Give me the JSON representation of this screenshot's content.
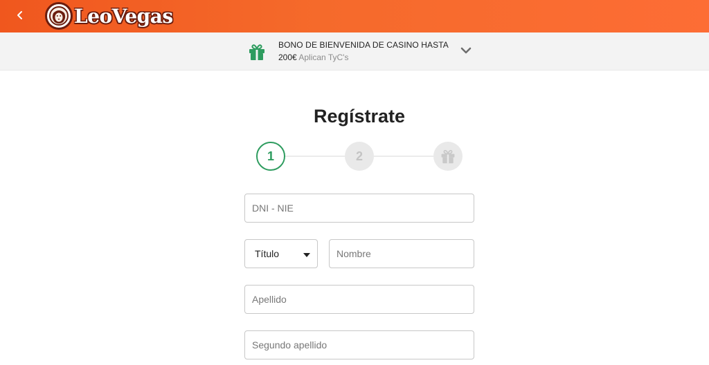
{
  "header": {
    "brand_name": "LeoVegas",
    "brand_color": "#f56a2b",
    "back_icon": "chevron-left-icon"
  },
  "bonus": {
    "icon": "gift-icon",
    "headline": "BONO DE BIENVENIDA DE CASINO HASTA",
    "amount": "200€",
    "terms": "Aplican TyC's",
    "expand_icon": "chevron-down-icon"
  },
  "main": {
    "title": "Regístrate"
  },
  "stepper": {
    "steps": [
      {
        "label": "1",
        "state": "active"
      },
      {
        "label": "2",
        "state": "inactive"
      },
      {
        "icon": "gift-icon",
        "state": "inactive"
      }
    ],
    "active_color": "#2e9c5f"
  },
  "form": {
    "dni_placeholder": "DNI - NIE",
    "titulo_selected": "Título",
    "nombre_placeholder": "Nombre",
    "apellido_placeholder": "Apellido",
    "segundo_apellido_placeholder": "Segundo apellido"
  }
}
